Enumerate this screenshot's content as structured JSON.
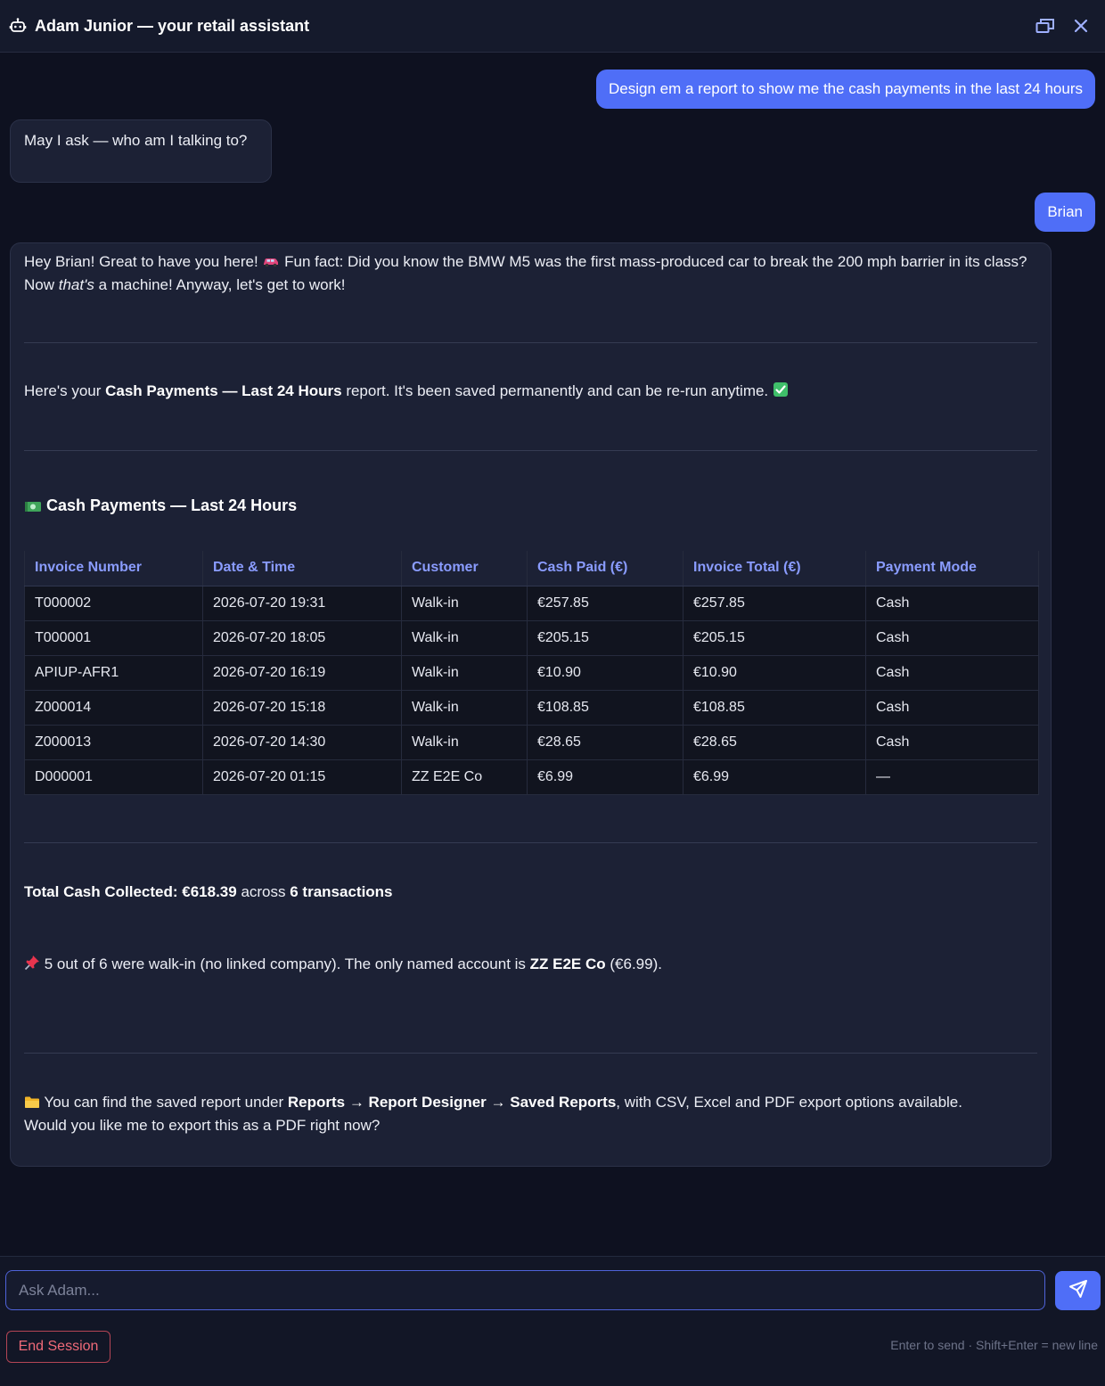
{
  "header": {
    "title": "Adam Junior — your retail assistant",
    "bot_icon": "robot-icon",
    "restore_icon": "window-restore-icon",
    "close_icon": "close-icon"
  },
  "messages": {
    "user_1": "Design em a report to show me the cash payments in the last 24 hours",
    "bot_1": "May I ask — who am I talking to?",
    "user_2": "Brian",
    "bot_2": {
      "intro_a": "Hey Brian! Great to have you here! ",
      "intro_b": " Fun fact: Did you know the BMW M5 was the first mass-produced car to break the 200 mph barrier in its class? Now ",
      "intro_em": "that's",
      "intro_c": " a machine! Anyway, let's get to work!",
      "report_a": "Here's your ",
      "report_b": "Cash Payments — Last 24 Hours",
      "report_c": " report. It's been saved permanently and can be re-run anytime. ",
      "heading": "Cash Payments — Last 24 Hours",
      "table": {
        "headers": [
          "Invoice Number",
          "Date & Time",
          "Customer",
          "Cash Paid (€)",
          "Invoice Total (€)",
          "Payment Mode"
        ],
        "rows": [
          [
            "T000002",
            "2026-07-20 19:31",
            "Walk-in",
            "€257.85",
            "€257.85",
            "Cash"
          ],
          [
            "T000001",
            "2026-07-20 18:05",
            "Walk-in",
            "€205.15",
            "€205.15",
            "Cash"
          ],
          [
            "APIUP-AFR1",
            "2026-07-20 16:19",
            "Walk-in",
            "€10.90",
            "€10.90",
            "Cash"
          ],
          [
            "Z000014",
            "2026-07-20 15:18",
            "Walk-in",
            "€108.85",
            "€108.85",
            "Cash"
          ],
          [
            "Z000013",
            "2026-07-20 14:30",
            "Walk-in",
            "€28.65",
            "€28.65",
            "Cash"
          ],
          [
            "D000001",
            "2026-07-20 01:15",
            "ZZ E2E Co",
            "€6.99",
            "€6.99",
            "—"
          ]
        ]
      },
      "total_a": "Total Cash Collected: €618.39",
      "total_b": " across ",
      "total_c": "6 transactions",
      "note_a": " 5 out of 6 were walk-in (no linked company). The only named account is ",
      "note_b": "ZZ E2E Co",
      "note_c": " (€6.99).",
      "saved_a": " You can find the saved report under ",
      "saved_b": "Reports → Report Designer → Saved Reports",
      "saved_c": ", with CSV, Excel and PDF export options available.",
      "saved_d": "Would you like me to export this as a PDF right now?"
    }
  },
  "composer": {
    "placeholder": "Ask Adam...",
    "send_icon": "send-icon",
    "end_session": "End Session",
    "hint": "Enter to send · Shift+Enter = new line"
  },
  "colors": {
    "accent": "#4f6ef7",
    "table_header": "#8a9cff",
    "danger": "#f06a78"
  }
}
